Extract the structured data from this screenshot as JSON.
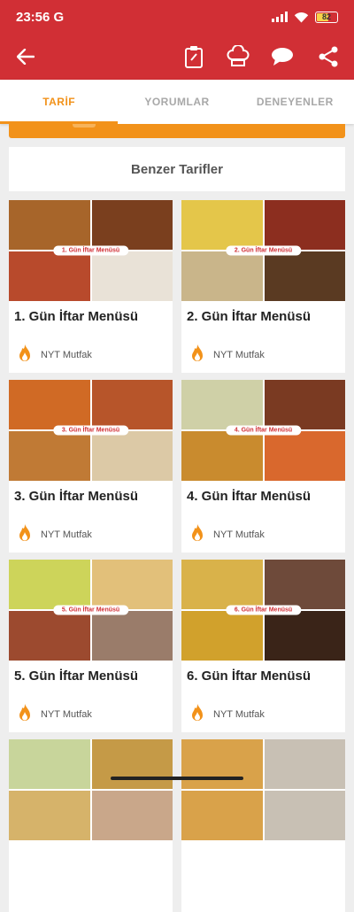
{
  "status": {
    "time": "23:56",
    "carrier": "G",
    "battery": "82"
  },
  "tabs": [
    {
      "label": "TARİF",
      "active": true
    },
    {
      "label": "YORUMLAR",
      "active": false
    },
    {
      "label": "DENEYENLER",
      "active": false
    }
  ],
  "similar": {
    "title": "Benzer Tarifler"
  },
  "cards": [
    {
      "title": "1. Gün İftar Menüsü",
      "badge": "1. Gün İftar Menüsü",
      "author": "NYT Mutfak",
      "colors": [
        "#a7652a",
        "#7a3f1e",
        "#b84a2c",
        "#e9e2d7"
      ]
    },
    {
      "title": "2. Gün İftar Menüsü",
      "badge": "2. Gün İftar Menüsü",
      "author": "NYT Mutfak",
      "colors": [
        "#e4c64a",
        "#8c2e1f",
        "#c9b58a",
        "#5a3a22"
      ]
    },
    {
      "title": "3. Gün İftar Menüsü",
      "badge": "3. Gün İftar Menüsü",
      "author": "NYT Mutfak",
      "colors": [
        "#d06a25",
        "#b7552a",
        "#c07a35",
        "#dcc9a6"
      ]
    },
    {
      "title": "4. Gün İftar Menüsü",
      "badge": "4. Gün İftar Menüsü",
      "author": "NYT Mutfak",
      "colors": [
        "#cfd0a7",
        "#7a3a22",
        "#c98b2e",
        "#d9682d"
      ]
    },
    {
      "title": "5. Gün İftar Menüsü",
      "badge": "5. Gün İftar Menüsü",
      "author": "NYT Mutfak",
      "colors": [
        "#cdd45a",
        "#e2c07a",
        "#9c4a2f",
        "#9a7c6a"
      ]
    },
    {
      "title": "6. Gün İftar Menüsü",
      "badge": "6. Gün İftar Menüsü",
      "author": "NYT Mutfak",
      "colors": [
        "#d9b24a",
        "#6e4a3a",
        "#d1a12c",
        "#3a2418"
      ]
    },
    {
      "title": "",
      "badge": "",
      "author": "",
      "colors": [
        "#c8d59b",
        "#c59a47",
        "#d6b36a",
        "#c9a78a"
      ]
    },
    {
      "title": "",
      "badge": "",
      "author": "",
      "colors": [
        "#d9a24a",
        "#c8c0b4",
        "#d9a24a",
        "#c8c0b4"
      ]
    }
  ],
  "accent": "#d12f35",
  "tab_accent": "#f2921a"
}
